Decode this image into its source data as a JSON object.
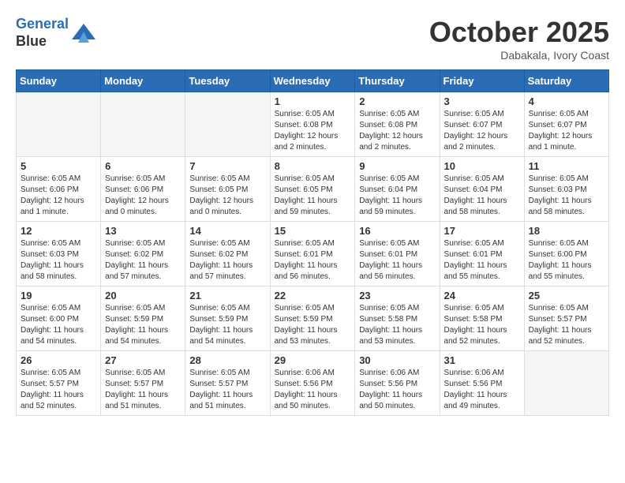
{
  "header": {
    "logo_line1": "General",
    "logo_line2": "Blue",
    "month": "October 2025",
    "location": "Dabakala, Ivory Coast"
  },
  "weekdays": [
    "Sunday",
    "Monday",
    "Tuesday",
    "Wednesday",
    "Thursday",
    "Friday",
    "Saturday"
  ],
  "weeks": [
    [
      {
        "day": "",
        "info": ""
      },
      {
        "day": "",
        "info": ""
      },
      {
        "day": "",
        "info": ""
      },
      {
        "day": "1",
        "info": "Sunrise: 6:05 AM\nSunset: 6:08 PM\nDaylight: 12 hours and 2 minutes."
      },
      {
        "day": "2",
        "info": "Sunrise: 6:05 AM\nSunset: 6:08 PM\nDaylight: 12 hours and 2 minutes."
      },
      {
        "day": "3",
        "info": "Sunrise: 6:05 AM\nSunset: 6:07 PM\nDaylight: 12 hours and 2 minutes."
      },
      {
        "day": "4",
        "info": "Sunrise: 6:05 AM\nSunset: 6:07 PM\nDaylight: 12 hours and 1 minute."
      }
    ],
    [
      {
        "day": "5",
        "info": "Sunrise: 6:05 AM\nSunset: 6:06 PM\nDaylight: 12 hours and 1 minute."
      },
      {
        "day": "6",
        "info": "Sunrise: 6:05 AM\nSunset: 6:06 PM\nDaylight: 12 hours and 0 minutes."
      },
      {
        "day": "7",
        "info": "Sunrise: 6:05 AM\nSunset: 6:05 PM\nDaylight: 12 hours and 0 minutes."
      },
      {
        "day": "8",
        "info": "Sunrise: 6:05 AM\nSunset: 6:05 PM\nDaylight: 11 hours and 59 minutes."
      },
      {
        "day": "9",
        "info": "Sunrise: 6:05 AM\nSunset: 6:04 PM\nDaylight: 11 hours and 59 minutes."
      },
      {
        "day": "10",
        "info": "Sunrise: 6:05 AM\nSunset: 6:04 PM\nDaylight: 11 hours and 58 minutes."
      },
      {
        "day": "11",
        "info": "Sunrise: 6:05 AM\nSunset: 6:03 PM\nDaylight: 11 hours and 58 minutes."
      }
    ],
    [
      {
        "day": "12",
        "info": "Sunrise: 6:05 AM\nSunset: 6:03 PM\nDaylight: 11 hours and 58 minutes."
      },
      {
        "day": "13",
        "info": "Sunrise: 6:05 AM\nSunset: 6:02 PM\nDaylight: 11 hours and 57 minutes."
      },
      {
        "day": "14",
        "info": "Sunrise: 6:05 AM\nSunset: 6:02 PM\nDaylight: 11 hours and 57 minutes."
      },
      {
        "day": "15",
        "info": "Sunrise: 6:05 AM\nSunset: 6:01 PM\nDaylight: 11 hours and 56 minutes."
      },
      {
        "day": "16",
        "info": "Sunrise: 6:05 AM\nSunset: 6:01 PM\nDaylight: 11 hours and 56 minutes."
      },
      {
        "day": "17",
        "info": "Sunrise: 6:05 AM\nSunset: 6:01 PM\nDaylight: 11 hours and 55 minutes."
      },
      {
        "day": "18",
        "info": "Sunrise: 6:05 AM\nSunset: 6:00 PM\nDaylight: 11 hours and 55 minutes."
      }
    ],
    [
      {
        "day": "19",
        "info": "Sunrise: 6:05 AM\nSunset: 6:00 PM\nDaylight: 11 hours and 54 minutes."
      },
      {
        "day": "20",
        "info": "Sunrise: 6:05 AM\nSunset: 5:59 PM\nDaylight: 11 hours and 54 minutes."
      },
      {
        "day": "21",
        "info": "Sunrise: 6:05 AM\nSunset: 5:59 PM\nDaylight: 11 hours and 54 minutes."
      },
      {
        "day": "22",
        "info": "Sunrise: 6:05 AM\nSunset: 5:59 PM\nDaylight: 11 hours and 53 minutes."
      },
      {
        "day": "23",
        "info": "Sunrise: 6:05 AM\nSunset: 5:58 PM\nDaylight: 11 hours and 53 minutes."
      },
      {
        "day": "24",
        "info": "Sunrise: 6:05 AM\nSunset: 5:58 PM\nDaylight: 11 hours and 52 minutes."
      },
      {
        "day": "25",
        "info": "Sunrise: 6:05 AM\nSunset: 5:57 PM\nDaylight: 11 hours and 52 minutes."
      }
    ],
    [
      {
        "day": "26",
        "info": "Sunrise: 6:05 AM\nSunset: 5:57 PM\nDaylight: 11 hours and 52 minutes."
      },
      {
        "day": "27",
        "info": "Sunrise: 6:05 AM\nSunset: 5:57 PM\nDaylight: 11 hours and 51 minutes."
      },
      {
        "day": "28",
        "info": "Sunrise: 6:05 AM\nSunset: 5:57 PM\nDaylight: 11 hours and 51 minutes."
      },
      {
        "day": "29",
        "info": "Sunrise: 6:06 AM\nSunset: 5:56 PM\nDaylight: 11 hours and 50 minutes."
      },
      {
        "day": "30",
        "info": "Sunrise: 6:06 AM\nSunset: 5:56 PM\nDaylight: 11 hours and 50 minutes."
      },
      {
        "day": "31",
        "info": "Sunrise: 6:06 AM\nSunset: 5:56 PM\nDaylight: 11 hours and 49 minutes."
      },
      {
        "day": "",
        "info": ""
      }
    ]
  ]
}
